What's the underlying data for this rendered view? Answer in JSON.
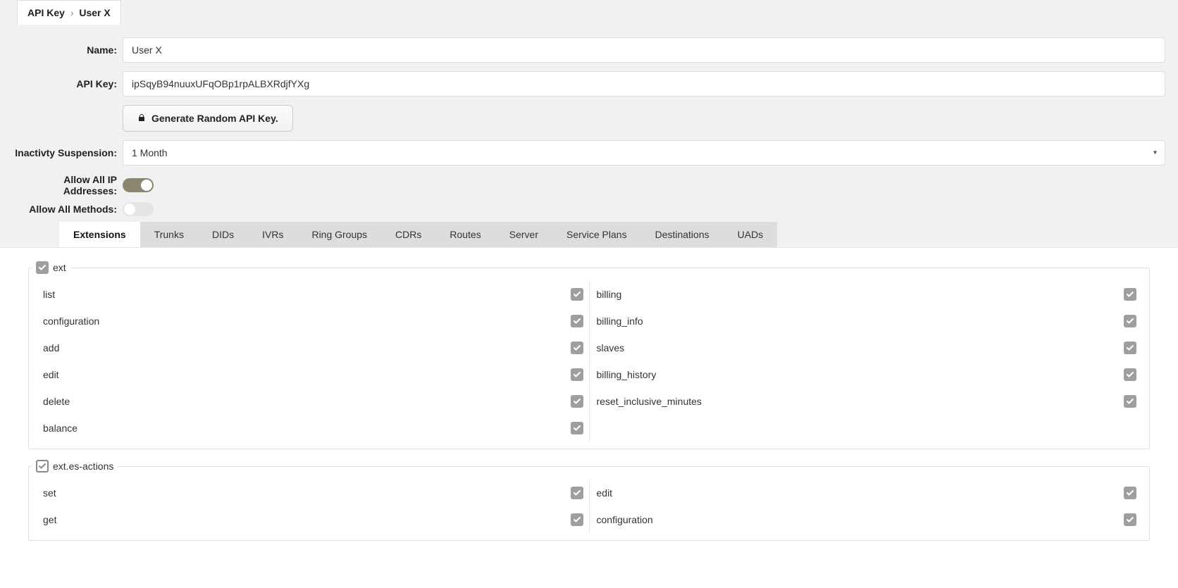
{
  "breadcrumb": {
    "root": "API Key",
    "sep": "›",
    "leaf": "User X"
  },
  "form": {
    "name_label": "Name:",
    "name_value": "User X",
    "apikey_label": "API Key:",
    "apikey_value": "ipSqyB94nuuxUFqOBp1rpALBXRdjfYXg",
    "generate_label": "Generate Random API Key.",
    "inactivity_label": "Inactivty Suspension:",
    "inactivity_value": "1 Month",
    "allow_ip_label": "Allow All IP Addresses:",
    "allow_methods_label": "Allow All Methods:"
  },
  "tabs": [
    "Extensions",
    "Trunks",
    "DIDs",
    "IVRs",
    "Ring Groups",
    "CDRs",
    "Routes",
    "Server",
    "Service Plans",
    "Destinations",
    "UADs"
  ],
  "groups": {
    "ext": {
      "title": "ext",
      "left": [
        "list",
        "configuration",
        "add",
        "edit",
        "delete",
        "balance"
      ],
      "right": [
        "billing",
        "billing_info",
        "slaves",
        "billing_history",
        "reset_inclusive_minutes"
      ]
    },
    "esactions": {
      "title": "ext.es-actions",
      "left": [
        "set",
        "get"
      ],
      "right": [
        "edit",
        "configuration"
      ]
    }
  }
}
